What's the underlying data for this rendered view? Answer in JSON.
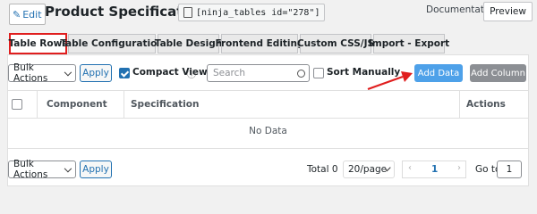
{
  "header": {
    "edit_label": "Edit",
    "page_title": "Product Specification Table",
    "shortcode": "[ninja_tables id=\"278\"]",
    "documentation_label": "Documentation",
    "preview_label": "Preview"
  },
  "tabs": [
    {
      "label": "Table Rows",
      "active": true
    },
    {
      "label": "Table Configuration",
      "active": false
    },
    {
      "label": "Table Design",
      "active": false
    },
    {
      "label": "Frontend Editing",
      "active": false
    },
    {
      "label": "Custom CSS/JS",
      "active": false
    },
    {
      "label": "Import - Export",
      "active": false
    }
  ],
  "toolbar": {
    "bulk_actions_label": "Bulk Actions",
    "apply_label": "Apply",
    "compact_view_label": "Compact View",
    "compact_view_checked": true,
    "search_placeholder": "Search",
    "sort_manually_label": "Sort Manually",
    "sort_manually_checked": false,
    "add_data_label": "Add Data",
    "add_column_label": "Add Column"
  },
  "table": {
    "columns": [
      "Component",
      "Specification",
      "Actions"
    ],
    "empty_text": "No Data"
  },
  "footer": {
    "bulk_actions_label": "Bulk Actions",
    "apply_label": "Apply",
    "total_label": "Total 0",
    "page_size_label": "20/page",
    "current_page": "1",
    "goto_label": "Go to",
    "goto_value": "1"
  },
  "colors": {
    "annotation_red": "#e01e1e",
    "accent_blue": "#2271b1",
    "primary_button": "#4ea1e9"
  }
}
